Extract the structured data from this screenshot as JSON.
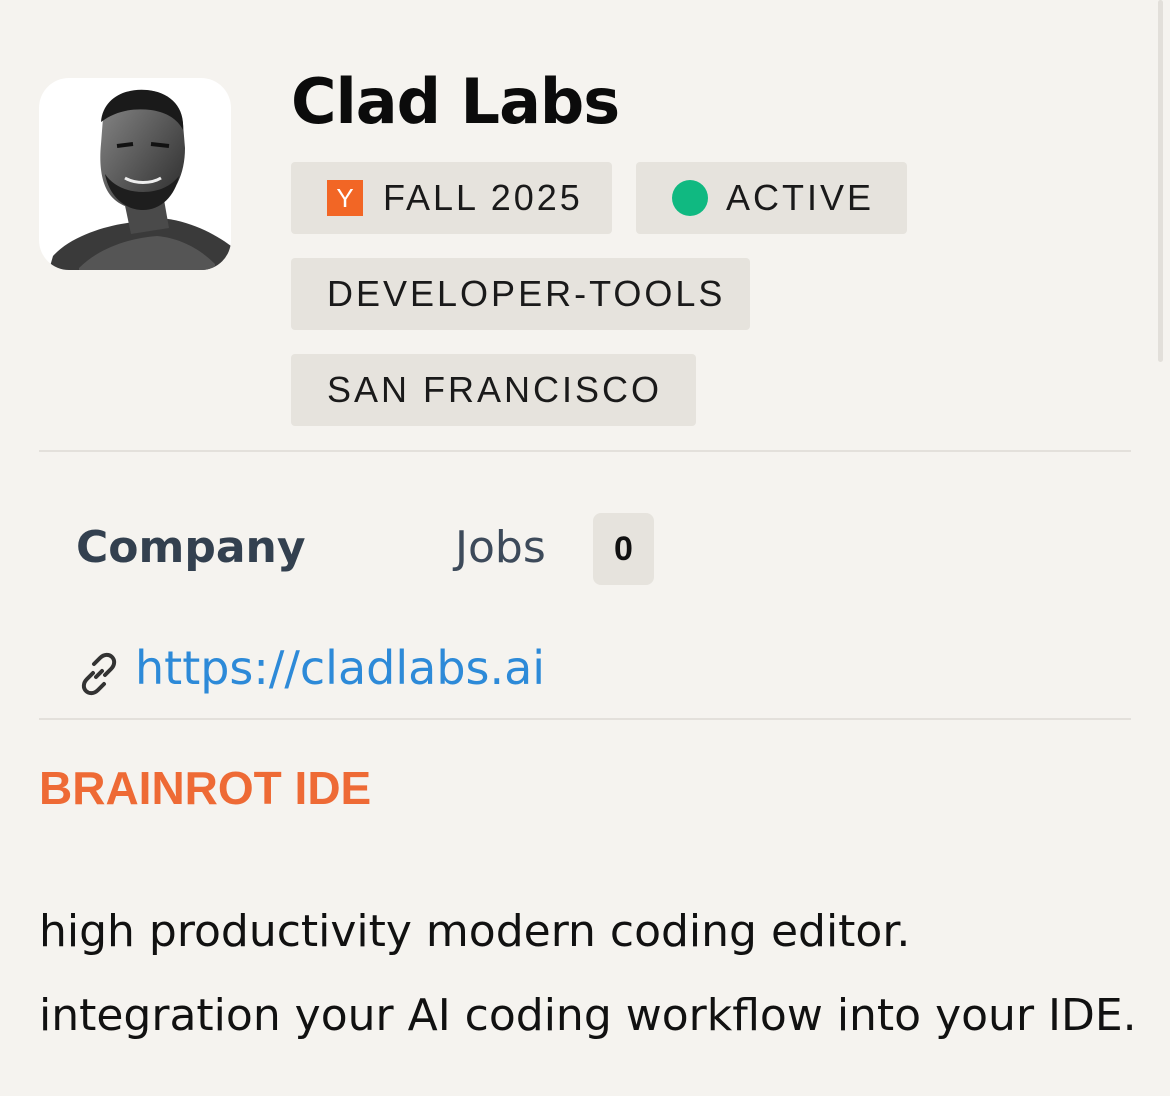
{
  "company": {
    "name": "Clad Labs",
    "logo": "chad-portrait-logo"
  },
  "tags": {
    "batch_icon": "Y",
    "batch": "FALL 2025",
    "status": "ACTIVE",
    "industry": "DEVELOPER-TOOLS",
    "location": "SAN FRANCISCO"
  },
  "tabs": {
    "company": "Company",
    "jobs": "Jobs",
    "jobs_count": "0"
  },
  "website": {
    "url": "https://cladlabs.ai",
    "icon": "link-icon"
  },
  "product": {
    "headline": "BRAINROT IDE",
    "description_line1": "high productivity modern coding editor.",
    "description_line2": "integration your AI coding workflow into your IDE."
  },
  "colors": {
    "background": "#f5f3ef",
    "tag_background": "#e6e3dd",
    "yc_orange": "#f26625",
    "active_green": "#10b981",
    "link_blue": "#2d8ad8",
    "headline_orange": "#ee6a35"
  }
}
